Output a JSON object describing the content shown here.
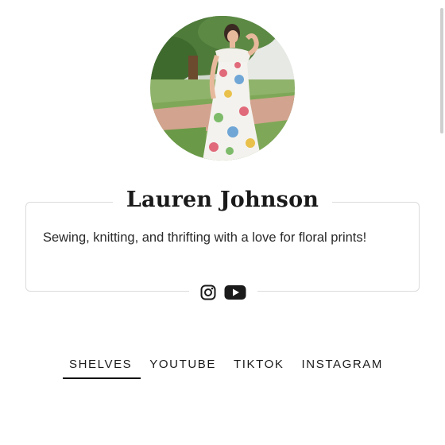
{
  "profile": {
    "name": "Lauren Johnson",
    "bio": "Sewing, knitting, and thrifting with a love for floral prints!",
    "avatar_alt": "profile-photo"
  },
  "socials": [
    {
      "icon": "instagram-icon"
    },
    {
      "icon": "youtube-icon"
    }
  ],
  "tabs": [
    {
      "label": "SHELVES",
      "active": true
    },
    {
      "label": "YOUTUBE",
      "active": false
    },
    {
      "label": "TIKTOK",
      "active": false
    },
    {
      "label": "INSTAGRAM",
      "active": false
    }
  ],
  "colors": {
    "text": "#1b1b1b",
    "border": "#dcdcdc",
    "active_underline": "#111111"
  }
}
